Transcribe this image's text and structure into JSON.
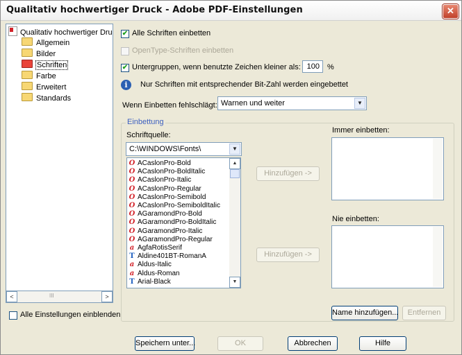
{
  "window": {
    "title": "Qualitativ hochwertiger Druck - Adobe PDF-Einstellungen",
    "close_glyph": "✕"
  },
  "tree": {
    "root_label": "Qualitativ hochwertiger Druc",
    "items": [
      {
        "label": "Allgemein",
        "selected": false
      },
      {
        "label": "Bilder",
        "selected": false
      },
      {
        "label": "Schriften",
        "selected": true
      },
      {
        "label": "Farbe",
        "selected": false
      },
      {
        "label": "Erweitert",
        "selected": false
      },
      {
        "label": "Standards",
        "selected": false
      }
    ],
    "scroll_left": "<",
    "scroll_thumb": "III",
    "scroll_right": ">"
  },
  "show_all": {
    "label": "Alle Einstellungen einblenden",
    "checked": false
  },
  "options": {
    "embed_all_label": "Alle Schriften einbetten",
    "opentype_label": "OpenType-Schriften einbetten",
    "subset_label": "Untergruppen, wenn benutzte Zeichen kleiner als:",
    "subset_value": "100",
    "subset_unit": "%",
    "info_text": "Nur Schriften mit entsprechender Bit-Zahl werden eingebettet",
    "check_glyph": "✔",
    "info_glyph": "i"
  },
  "fail": {
    "label": "Wenn Einbetten fehlschlägt:",
    "value": "Warnen und weiter",
    "arrow": "▼"
  },
  "embedding": {
    "legend": "Einbettung",
    "source_label": "Schriftquelle:",
    "source_value": "C:\\WINDOWS\\Fonts\\",
    "fonts": [
      {
        "name": "ACaslonPro-Bold",
        "icon": "O"
      },
      {
        "name": "ACaslonPro-BoldItalic",
        "icon": "O"
      },
      {
        "name": "ACaslonPro-Italic",
        "icon": "O"
      },
      {
        "name": "ACaslonPro-Regular",
        "icon": "O"
      },
      {
        "name": "ACaslonPro-Semibold",
        "icon": "O"
      },
      {
        "name": "ACaslonPro-SemiboldItalic",
        "icon": "O"
      },
      {
        "name": "AGaramondPro-Bold",
        "icon": "O"
      },
      {
        "name": "AGaramondPro-BoldItalic",
        "icon": "O"
      },
      {
        "name": "AGaramondPro-Italic",
        "icon": "O"
      },
      {
        "name": "AGaramondPro-Regular",
        "icon": "O"
      },
      {
        "name": "AgfaRotisSerif",
        "icon": "a"
      },
      {
        "name": "Aldine401BT-RomanA",
        "icon": "T"
      },
      {
        "name": "Aldus-Italic",
        "icon": "a"
      },
      {
        "name": "Aldus-Roman",
        "icon": "a"
      },
      {
        "name": "Arial-Black",
        "icon": "T"
      }
    ],
    "add_always_label": "Hinzufügen ->",
    "add_never_label": "Hinzufügen ->",
    "always_label": "Immer einbetten:",
    "never_label": "Nie einbetten:",
    "add_name_label": "Name hinzufügen...",
    "remove_label": "Entfernen",
    "scroll_up": "▲",
    "scroll_down": "▼"
  },
  "footer": {
    "save_as": "Speichern unter...",
    "ok": "OK",
    "cancel": "Abbrechen",
    "help": "Hilfe"
  },
  "colors": {
    "accent": "#3c5fbf",
    "close": "#c0402a",
    "selected_folder": "#e9443a",
    "font_icon_o": "#d2232a",
    "font_icon_t": "#2060c0"
  }
}
